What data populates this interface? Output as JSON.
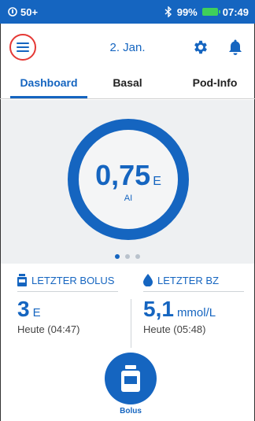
{
  "status_bar": {
    "left_text": "50+",
    "bluetooth_icon": "bluetooth-icon",
    "battery_percent": "99%",
    "time": "07:49",
    "battery_color": "#3fd05a"
  },
  "header": {
    "date": "2. Jan.",
    "menu_icon": "hamburger-menu-icon",
    "settings_icon": "gear-icon",
    "notifications_icon": "bell-icon"
  },
  "tabs": [
    {
      "label": "Dashboard",
      "active": true
    },
    {
      "label": "Basal",
      "active": false
    },
    {
      "label": "Pod-Info",
      "active": false
    }
  ],
  "dashboard": {
    "value": "0,75",
    "unit": "E",
    "label": "AI",
    "pager": {
      "count": 3,
      "active_index": 0
    }
  },
  "last_bolus": {
    "title": "LETZTER BOLUS",
    "value": "3",
    "unit": "E",
    "time": "Heute (04:47)"
  },
  "last_bg": {
    "title": "LETZTER BZ",
    "value": "5,1",
    "unit": "mmol/L",
    "time": "Heute (05:48)"
  },
  "bolus_button": {
    "label": "Bolus"
  },
  "colors": {
    "primary": "#1565c0",
    "menu_highlight": "#e53935"
  }
}
